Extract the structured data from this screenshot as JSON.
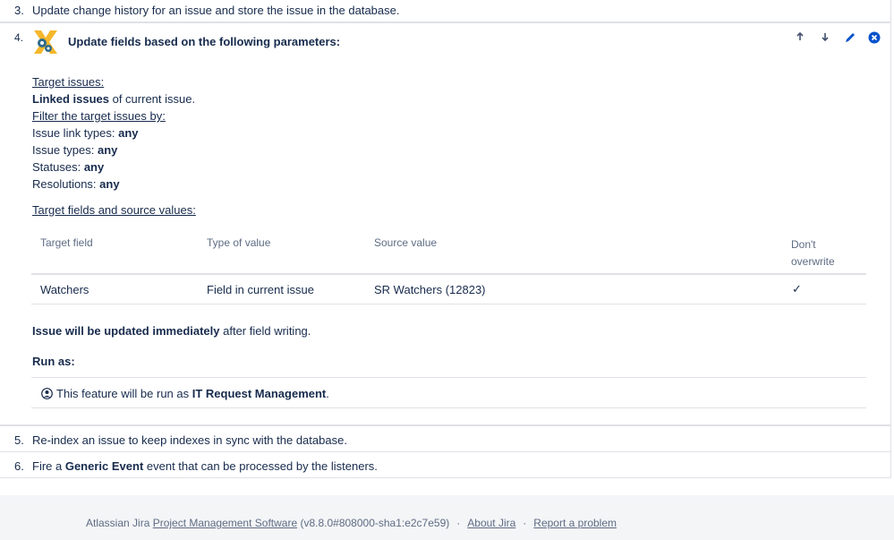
{
  "steps": {
    "s3": {
      "num": "3.",
      "text": "Update change history for an issue and store the issue in the database."
    },
    "s4": {
      "num": "4.",
      "title": "Update fields based on the following parameters:",
      "target_issues_label": "Target issues:",
      "linked_issues_bold": "Linked issues",
      "linked_issues_rest": " of current issue.",
      "filter_label": "Filter the target issues by:",
      "filters": [
        {
          "label": "Issue link types: ",
          "value": "any"
        },
        {
          "label": "Issue types: ",
          "value": "any"
        },
        {
          "label": "Statuses: ",
          "value": "any"
        },
        {
          "label": "Resolutions: ",
          "value": "any"
        }
      ],
      "target_fields_label": "Target fields and source values:",
      "table": {
        "headers": [
          "Target field",
          "Type of value",
          "Source value",
          "Don't",
          "overwrite"
        ],
        "rows": [
          {
            "target_field": "Watchers",
            "type_of_value": "Field in current issue",
            "source_value": "SR Watchers (12823)",
            "dont_overwrite": "✓"
          }
        ]
      },
      "update_bold": "Issue will be updated immediately",
      "update_rest": " after field writing.",
      "run_as_label": "Run as:",
      "run_as_prefix": "This feature will be run as ",
      "run_as_user": "IT Request Management",
      "run_as_suffix": ".",
      "actions": {
        "up": "up-arrow",
        "down": "down-arrow",
        "edit": "pencil",
        "delete": "close"
      }
    },
    "s5": {
      "num": "5.",
      "text": "Re-index an issue to keep indexes in sync with the database."
    },
    "s6": {
      "num": "6.",
      "prefix": "Fire a ",
      "bold": "Generic Event",
      "suffix": " event that can be processed by the listeners."
    }
  },
  "footer": {
    "prefix": "Atlassian Jira ",
    "link_pm": "Project Management Software",
    "version": " (v8.8.0#808000-sha1:e2c7e59)",
    "dot1": "·",
    "about": "About Jira",
    "dot2": "·",
    "report": "Report a problem"
  },
  "colors": {
    "accent": "#0052cc",
    "border": "#dfe1e6",
    "footer_bg": "#f4f5f7"
  }
}
